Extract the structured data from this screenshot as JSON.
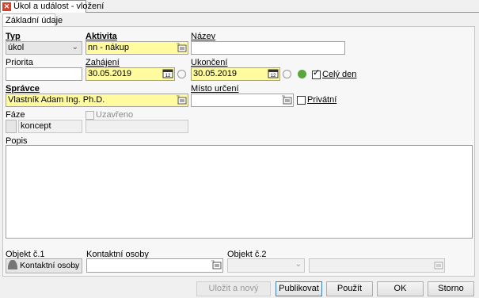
{
  "window": {
    "title": "Úkol a událost - vložení"
  },
  "tabs": [
    {
      "label": "Základní údaje"
    }
  ],
  "form": {
    "typ": {
      "label": "Typ",
      "value": "úkol"
    },
    "aktivita": {
      "label": "Aktivita",
      "value": "nn - nákup"
    },
    "nazev": {
      "label": "Název",
      "value": ""
    },
    "priorita": {
      "label": "Priorita",
      "value": ""
    },
    "zahajeni": {
      "label": "Zahájení",
      "value": "30.05.2019"
    },
    "ukonceni": {
      "label": "Ukončení",
      "value": "30.05.2019"
    },
    "cely_den": {
      "label": "Celý den",
      "checked": true
    },
    "spravce": {
      "label": "Správce",
      "value": "Vlastník Adam Ing. Ph.D."
    },
    "misto": {
      "label": "Místo určení",
      "value": ""
    },
    "privatni": {
      "label": "Privátní",
      "checked": false
    },
    "faze": {
      "label": "Fáze",
      "value": "koncept"
    },
    "uzavreno": {
      "label": "Uzavřeno",
      "checked": false
    },
    "popis": {
      "label": "Popis",
      "value": ""
    },
    "objekt1": {
      "label": "Objekt č.1",
      "value": "Kontaktní osoby"
    },
    "kontaktni_osoby": {
      "label": "Kontaktní osoby",
      "value": ""
    },
    "objekt2": {
      "label": "Objekt č.2",
      "value": ""
    }
  },
  "buttons": {
    "ulozit_novy": "Uložit a nový",
    "publikovat": "Publikovat",
    "pouzit": "Použít",
    "ok": "OK",
    "storno": "Storno"
  },
  "colors": {
    "required": "#fffb9e",
    "close": "#d9402b"
  }
}
